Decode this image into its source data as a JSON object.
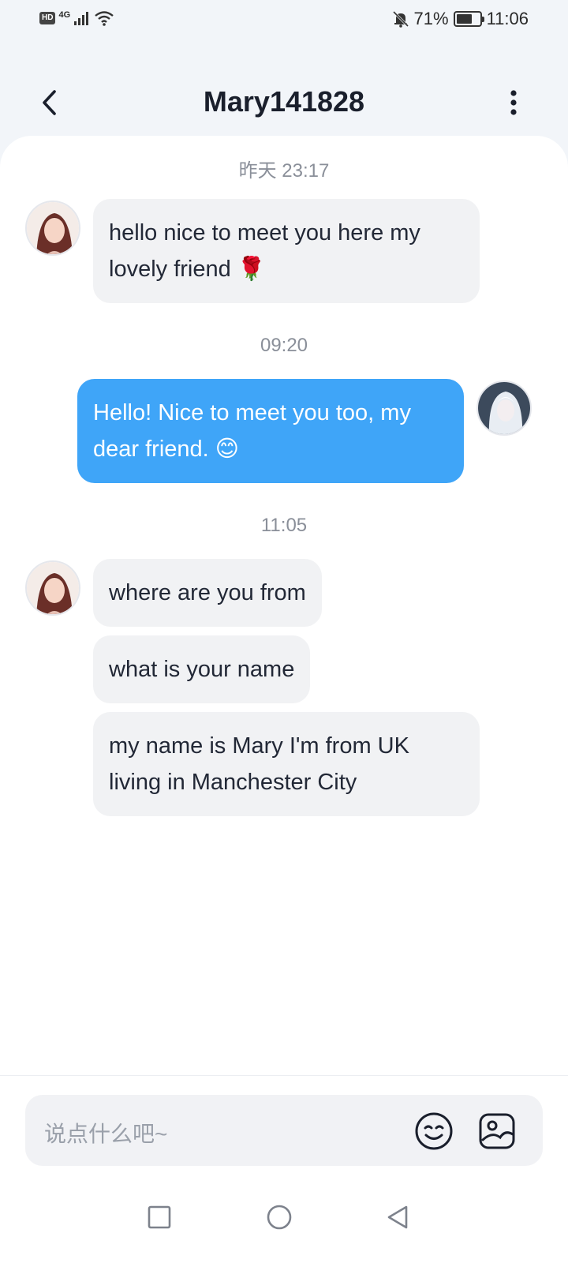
{
  "status_bar": {
    "left_badge": "HD",
    "network": "4G",
    "battery_percent_text": "71%",
    "battery_level": 0.71,
    "time": "11:06"
  },
  "header": {
    "title": "Mary141828"
  },
  "messages": {
    "time_1": "昨天 23:17",
    "msg_1": "hello nice to meet you here my lovely friend 🌹",
    "time_2": "09:20",
    "msg_2": "Hello! Nice to meet you too, my dear friend. 😊",
    "time_3": "11:05",
    "msg_3": "where are you from",
    "msg_4": "what is your name",
    "msg_5": "my name is Mary I'm from UK living in Manchester City"
  },
  "composer": {
    "placeholder": "说点什么吧~"
  },
  "colors": {
    "outgoing_bubble": "#3fa5f8",
    "incoming_bubble": "#f1f2f4"
  }
}
